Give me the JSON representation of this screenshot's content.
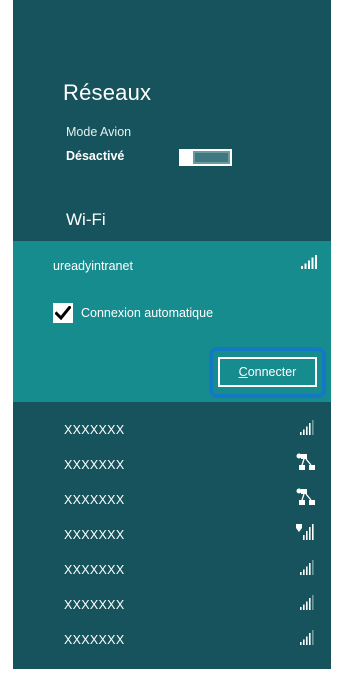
{
  "panel": {
    "title": "Réseaux",
    "airplane_mode": {
      "label": "Mode Avion",
      "state": "Désactivé"
    },
    "wifi_heading": "Wi-Fi"
  },
  "selected_network": {
    "name": "ureadyintranet",
    "signal_icon": "wifi-signal-full-icon",
    "auto_connect_label": "Connexion automatique",
    "auto_connect_checked": true,
    "connect_label": "Connecter",
    "connect_hotkey": "C"
  },
  "networks": [
    {
      "name": "XXXXXXX",
      "icon": "wifi-signal-icon"
    },
    {
      "name": "XXXXXXX",
      "icon": "ad-hoc-network-icon"
    },
    {
      "name": "XXXXXXX",
      "icon": "ad-hoc-network-icon"
    },
    {
      "name": "XXXXXXX",
      "icon": "secured-wifi-signal-icon"
    },
    {
      "name": "XXXXXXX",
      "icon": "wifi-signal-icon"
    },
    {
      "name": "XXXXXXX",
      "icon": "wifi-signal-icon"
    },
    {
      "name": "XXXXXXX",
      "icon": "wifi-signal-icon"
    }
  ],
  "colors": {
    "panel_bg": "#16535c",
    "selected_bg": "#168c8f",
    "focus_ring": "#1479c4",
    "text": "#ffffff"
  }
}
